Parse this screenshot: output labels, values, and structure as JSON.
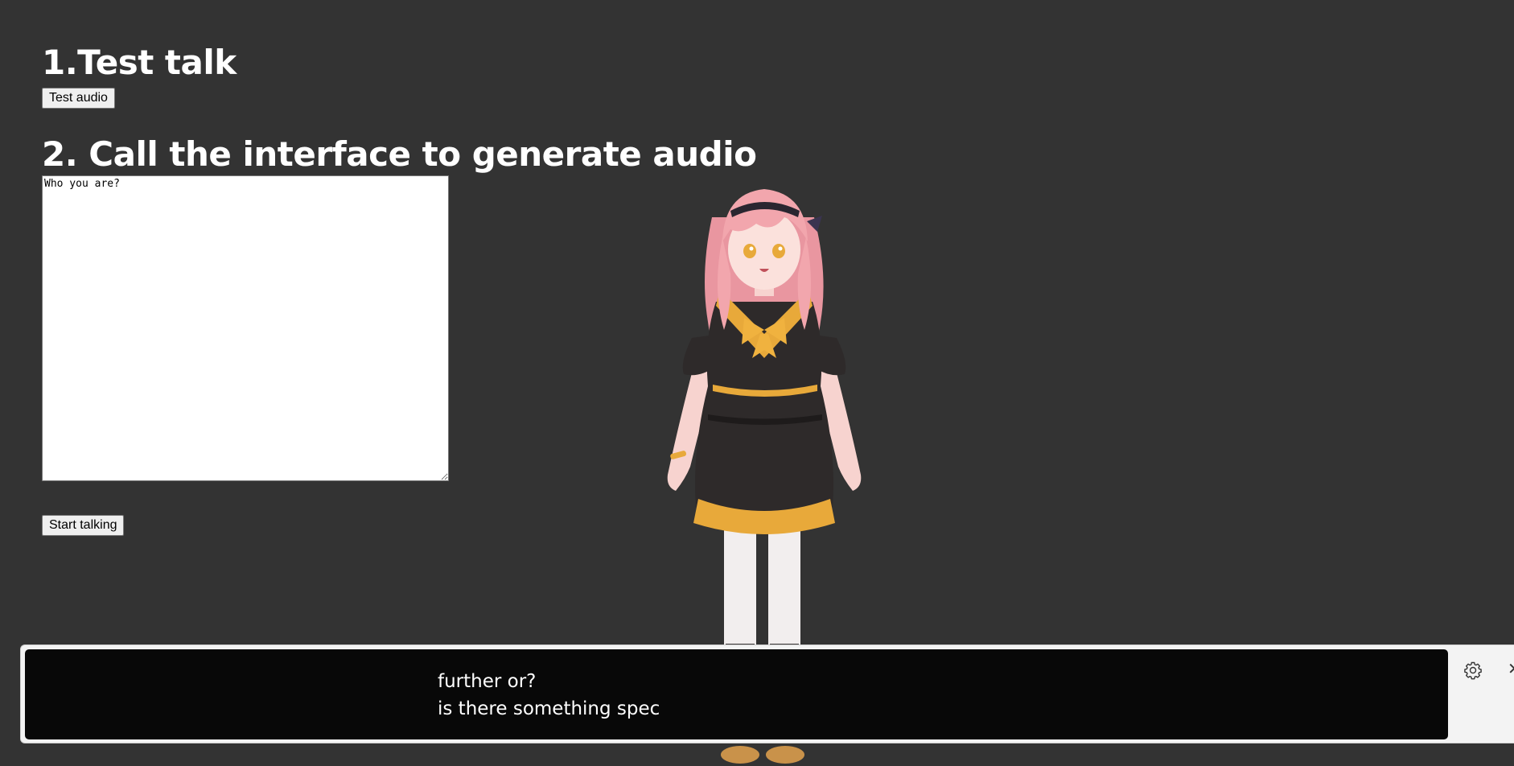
{
  "section1": {
    "heading": "1.Test talk",
    "button_label": "Test audio"
  },
  "section2": {
    "heading": "2. Call the interface to generate audio",
    "textarea_value": "Who you are?",
    "button_label": "Start talking"
  },
  "captions": {
    "line1": "further or?",
    "line2": "is there something spec",
    "settings_icon": "gear-icon",
    "close_icon": "close-icon"
  },
  "colors": {
    "page_background": "#333333",
    "caption_background": "#000000",
    "hair": "#f2a6ad",
    "dress": "#2e2a2a",
    "accent": "#e8a93a"
  }
}
